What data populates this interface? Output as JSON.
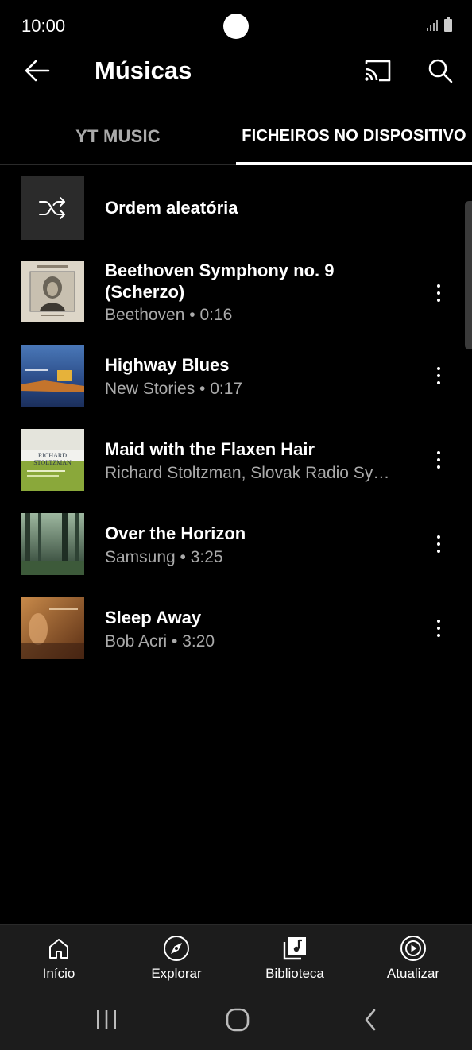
{
  "status_bar": {
    "time": "10:00"
  },
  "app_bar": {
    "title": "Músicas"
  },
  "tabs": [
    {
      "label": "YT MUSIC",
      "selected": false
    },
    {
      "label": "FICHEIROS NO DISPOSITIVO",
      "selected": true
    }
  ],
  "shuffle": {
    "label": "Ordem aleatória"
  },
  "songs": [
    {
      "title": "Beethoven Symphony no. 9 (Scherzo)",
      "subtitle": "Beethoven • 0:16"
    },
    {
      "title": "Highway Blues",
      "subtitle": "New Stories • 0:17"
    },
    {
      "title": "Maid with the Flaxen Hair",
      "subtitle": "Richard Stoltzman, Slovak Radio Sy…"
    },
    {
      "title": "Over the Horizon",
      "subtitle": "Samsung • 3:25"
    },
    {
      "title": "Sleep Away",
      "subtitle": "Bob Acri • 3:20"
    }
  ],
  "bottom_nav": [
    {
      "label": "Início",
      "icon": "home-icon"
    },
    {
      "label": "Explorar",
      "icon": "compass-icon"
    },
    {
      "label": "Biblioteca",
      "icon": "library-icon"
    },
    {
      "label": "Atualizar",
      "icon": "upgrade-icon"
    }
  ],
  "colors": {
    "background": "#000000",
    "secondary_text": "#aaaaaa",
    "nav_background": "#1c1c1c"
  }
}
